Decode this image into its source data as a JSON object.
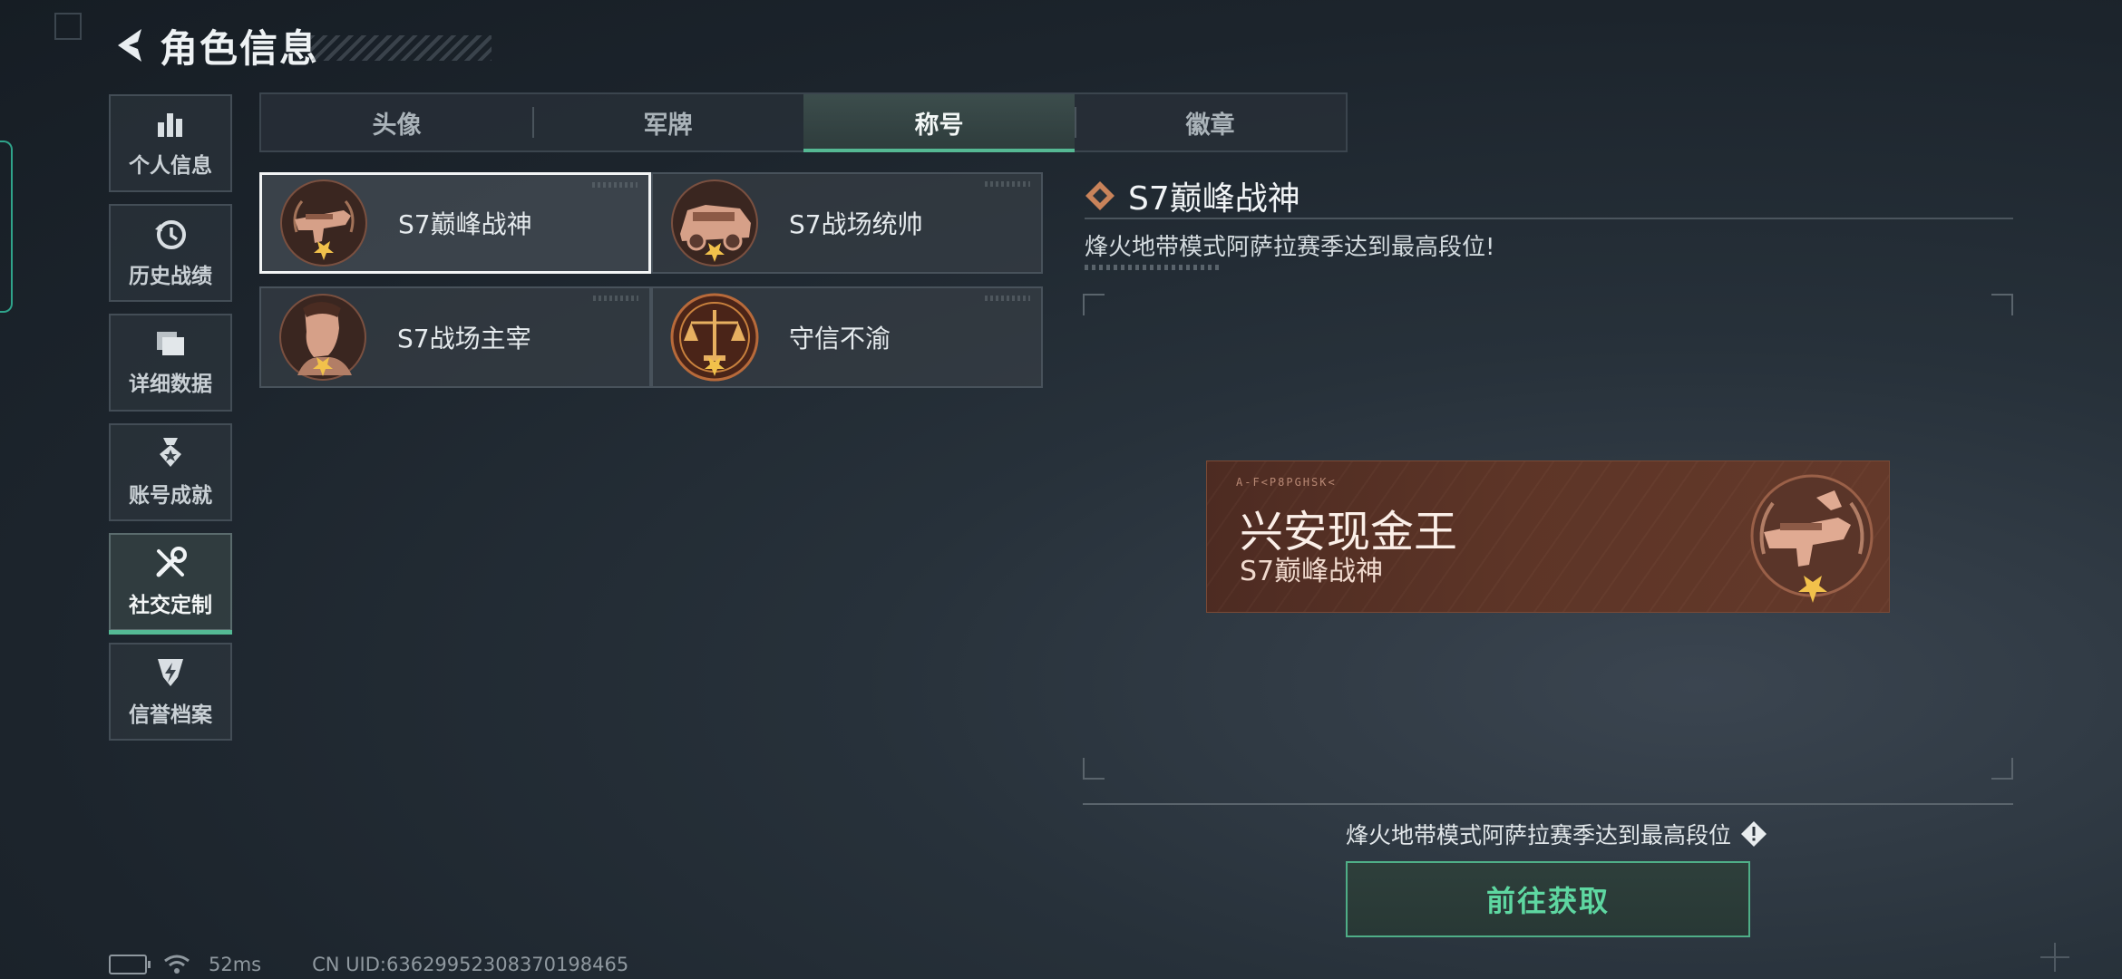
{
  "header": {
    "title": "角色信息"
  },
  "sidebar": {
    "items": [
      {
        "label": "个人信息",
        "icon": "bar-chart-icon"
      },
      {
        "label": "历史战绩",
        "icon": "clock-history-icon"
      },
      {
        "label": "详细数据",
        "icon": "folder-icon"
      },
      {
        "label": "账号成就",
        "icon": "medal-icon"
      },
      {
        "label": "社交定制",
        "icon": "tools-icon",
        "active": true
      },
      {
        "label": "信誉档案",
        "icon": "shield-bolt-icon"
      }
    ]
  },
  "tabs": [
    {
      "label": "头像"
    },
    {
      "label": "军牌"
    },
    {
      "label": "称号",
      "active": true
    },
    {
      "label": "徽章"
    }
  ],
  "titles": [
    {
      "name": "S7巅峰战神",
      "selected": true,
      "icon": "gun-medal-icon"
    },
    {
      "name": "S7战场统帅",
      "icon": "vehicle-medal-icon"
    },
    {
      "name": "S7战场主宰",
      "icon": "soldier-medal-icon"
    },
    {
      "name": "守信不渝",
      "icon": "scales-medal-icon"
    }
  ],
  "detail": {
    "title": "S7巅峰战神",
    "description": "烽火地带模式阿萨拉赛季达到最高段位!",
    "banner": {
      "code": "A-F<P8PGHSK<",
      "player_name": "兴安现金王",
      "title_name": "S7巅峰战神"
    },
    "requirement": "烽火地带模式阿萨拉赛季达到最高段位",
    "action_label": "前往获取"
  },
  "status_bar": {
    "ping": "52ms",
    "uid": "CN UID:63629952308370198465"
  },
  "colors": {
    "accent": "#55b893",
    "banner": "#5d3527",
    "button_text": "#5ed7a1"
  }
}
